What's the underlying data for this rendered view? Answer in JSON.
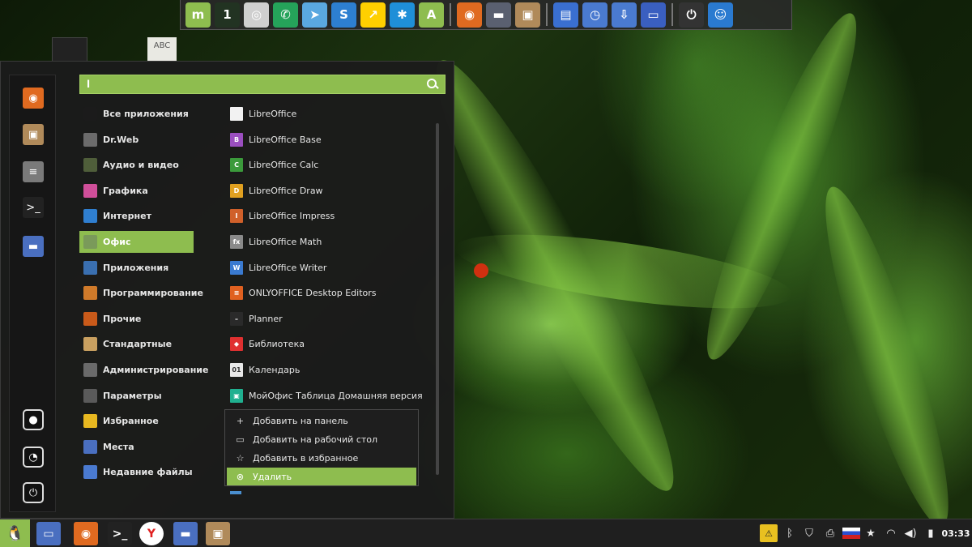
{
  "search": {
    "value": "l",
    "placeholder": ""
  },
  "categories": [
    {
      "label": "Все приложения",
      "icon": "grid-icon",
      "color": "#1b1b1b"
    },
    {
      "label": "Dr.Web",
      "icon": "drweb-icon",
      "color": "#6b6b6b"
    },
    {
      "label": "Аудио и видео",
      "icon": "multimedia-icon",
      "color": "#4f5e3a"
    },
    {
      "label": "Графика",
      "icon": "graphics-icon",
      "color": "#d04f9a"
    },
    {
      "label": "Интернет",
      "icon": "internet-icon",
      "color": "#2f7fd0"
    },
    {
      "label": "Офис",
      "icon": "office-icon",
      "color": "#7a9a5a",
      "active": true
    },
    {
      "label": "Приложения",
      "icon": "applications-icon",
      "color": "#3a6fb0"
    },
    {
      "label": "Программирование",
      "icon": "programming-icon",
      "color": "#d07a2a"
    },
    {
      "label": "Прочие",
      "icon": "other-icon",
      "color": "#c95a1a"
    },
    {
      "label": "Стандартные",
      "icon": "accessories-icon",
      "color": "#c9a060"
    },
    {
      "label": "Администрирование",
      "icon": "administration-icon",
      "color": "#6a6a6a"
    },
    {
      "label": "Параметры",
      "icon": "settings-icon",
      "color": "#5a5a5a"
    },
    {
      "label": "Избранное",
      "icon": "star-icon",
      "color": "#e8b820"
    },
    {
      "label": "Места",
      "icon": "places-folder-icon",
      "color": "#4a6fc0"
    },
    {
      "label": "Недавние файлы",
      "icon": "recent-files-icon",
      "color": "#4a7ad0"
    }
  ],
  "apps": [
    {
      "label": "LibreOffice",
      "icon": "libreoffice-icon",
      "color": "#f2f2f2",
      "glyph": ""
    },
    {
      "label": "LibreOffice Base",
      "icon": "libreoffice-base-icon",
      "color": "#9b4fc0",
      "glyph": "B"
    },
    {
      "label": "LibreOffice Calc",
      "icon": "libreoffice-calc-icon",
      "color": "#3b9a3b",
      "glyph": "C"
    },
    {
      "label": "LibreOffice Draw",
      "icon": "libreoffice-draw-icon",
      "color": "#e0a020",
      "glyph": "D"
    },
    {
      "label": "LibreOffice Impress",
      "icon": "libreoffice-impress-icon",
      "color": "#d0602a",
      "glyph": "I"
    },
    {
      "label": "LibreOffice Math",
      "icon": "libreoffice-math-icon",
      "color": "#8a8a8a",
      "glyph": "fx"
    },
    {
      "label": "LibreOffice Writer",
      "icon": "libreoffice-writer-icon",
      "color": "#3a7ad0",
      "glyph": "W"
    },
    {
      "label": "ONLYOFFICE Desktop Editors",
      "icon": "onlyoffice-icon",
      "color": "#e06020",
      "glyph": "≡"
    },
    {
      "label": "Planner",
      "icon": "planner-icon",
      "color": "#2a2a2a",
      "glyph": "–"
    },
    {
      "label": "Библиотека",
      "icon": "library-icon",
      "color": "#e03030",
      "glyph": "◆"
    },
    {
      "label": "Календарь",
      "icon": "calendar-icon",
      "color": "#e8e8e8",
      "glyph": "01"
    },
    {
      "label": "МойОфис Таблица Домашняя версия",
      "icon": "myoffice-table-icon",
      "color": "#20b090",
      "glyph": "▣"
    }
  ],
  "context_menu": [
    {
      "label": "Добавить на панель",
      "glyph": "+",
      "icon": "plus-icon"
    },
    {
      "label": "Добавить на рабочий стол",
      "glyph": "▭",
      "icon": "desktop-icon"
    },
    {
      "label": "Добавить в избранное",
      "glyph": "☆",
      "icon": "star-outline-icon"
    },
    {
      "label": "Удалить",
      "glyph": "⊗",
      "icon": "remove-icon",
      "active": true
    }
  ],
  "desktop": {
    "abc_label": "ABC"
  },
  "top_dock": [
    {
      "name": "linux-mint-icon",
      "glyph": "m",
      "color": "#8ebd4f"
    },
    {
      "name": "system-monitor-icon",
      "glyph": "1",
      "color": "#223322"
    },
    {
      "name": "disc-burner-icon",
      "glyph": "◎",
      "color": "#cfcfcf"
    },
    {
      "name": "whatsapp-icon",
      "glyph": "✆",
      "color": "#25a35a"
    },
    {
      "name": "telegram-icon",
      "glyph": "➤",
      "color": "#5aa8e0"
    },
    {
      "name": "app-blue-icon",
      "glyph": "S",
      "color": "#2d7fd0"
    },
    {
      "name": "yandex-disk-icon",
      "glyph": "↗",
      "color": "#ffd000"
    },
    {
      "name": "snowflake-icon",
      "glyph": "✱",
      "color": "#1f8fd8"
    },
    {
      "name": "asian-app-icon",
      "glyph": "A",
      "color": "#8ebd4f"
    },
    {
      "name": "firefox-icon",
      "glyph": "◉",
      "color": "#e06a20"
    },
    {
      "name": "folder-dark-icon",
      "glyph": "▬",
      "color": "#5a6070"
    },
    {
      "name": "package-installer-icon",
      "glyph": "▣",
      "color": "#b08a5a"
    },
    {
      "name": "file-manager-icon",
      "glyph": "▤",
      "color": "#3a6fd0"
    },
    {
      "name": "backup-icon",
      "glyph": "◷",
      "color": "#4a7ad0"
    },
    {
      "name": "download-folder-icon",
      "glyph": "⇩",
      "color": "#4a7ad0"
    },
    {
      "name": "window-manager-icon",
      "glyph": "▭",
      "color": "#3a5fc0"
    },
    {
      "name": "power-icon",
      "glyph": "⏻",
      "color": "#333333"
    },
    {
      "name": "accessibility-icon",
      "glyph": "☺",
      "color": "#2a7ad0"
    }
  ],
  "favorites": [
    {
      "name": "firefox-icon",
      "glyph": "◉",
      "color": "#e06a20"
    },
    {
      "name": "package-installer-icon",
      "glyph": "▣",
      "color": "#b08a5a"
    },
    {
      "name": "mixer-settings-icon",
      "glyph": "≡",
      "color": "#7a7a7a"
    },
    {
      "name": "terminal-icon",
      "glyph": ">_",
      "color": "#222222"
    },
    {
      "name": "folder-icon",
      "glyph": "▬",
      "color": "#4a6fc0"
    }
  ],
  "session": [
    {
      "name": "lock-screen-icon",
      "glyph": "●"
    },
    {
      "name": "logout-icon",
      "glyph": "◔"
    },
    {
      "name": "shutdown-icon",
      "glyph": "⏻"
    }
  ],
  "taskbar": [
    {
      "name": "desktop-show-icon",
      "glyph": "▭",
      "color": "#4a6fc0"
    },
    {
      "name": "firefox-icon",
      "glyph": "◉",
      "color": "#e06a20"
    },
    {
      "name": "terminal-icon",
      "glyph": ">_",
      "color": "#222222"
    },
    {
      "name": "yandex-browser-icon",
      "glyph": "Y",
      "color": "#ffffff"
    },
    {
      "name": "folder-icon",
      "glyph": "▬",
      "color": "#4a6fc0"
    },
    {
      "name": "package-installer-icon",
      "glyph": "▣",
      "color": "#b08a5a"
    }
  ],
  "tray": [
    {
      "name": "update-warning-icon",
      "glyph": "⚠"
    },
    {
      "name": "bluetooth-icon",
      "glyph": "ᛒ"
    },
    {
      "name": "shield-icon",
      "glyph": "⛉"
    },
    {
      "name": "printer-icon",
      "glyph": "⎙"
    },
    {
      "name": "keyboard-layout-flag-icon",
      "glyph": ""
    },
    {
      "name": "favorites-star-icon",
      "glyph": "★"
    },
    {
      "name": "wifi-icon",
      "glyph": "◠"
    },
    {
      "name": "volume-icon",
      "glyph": "◀)"
    },
    {
      "name": "battery-icon",
      "glyph": "▮"
    }
  ],
  "clock": "03:33",
  "colors": {
    "accent": "#8ebd4f",
    "menu_bg": "#1b1b1b",
    "panel_bg": "#1f1f1f"
  }
}
